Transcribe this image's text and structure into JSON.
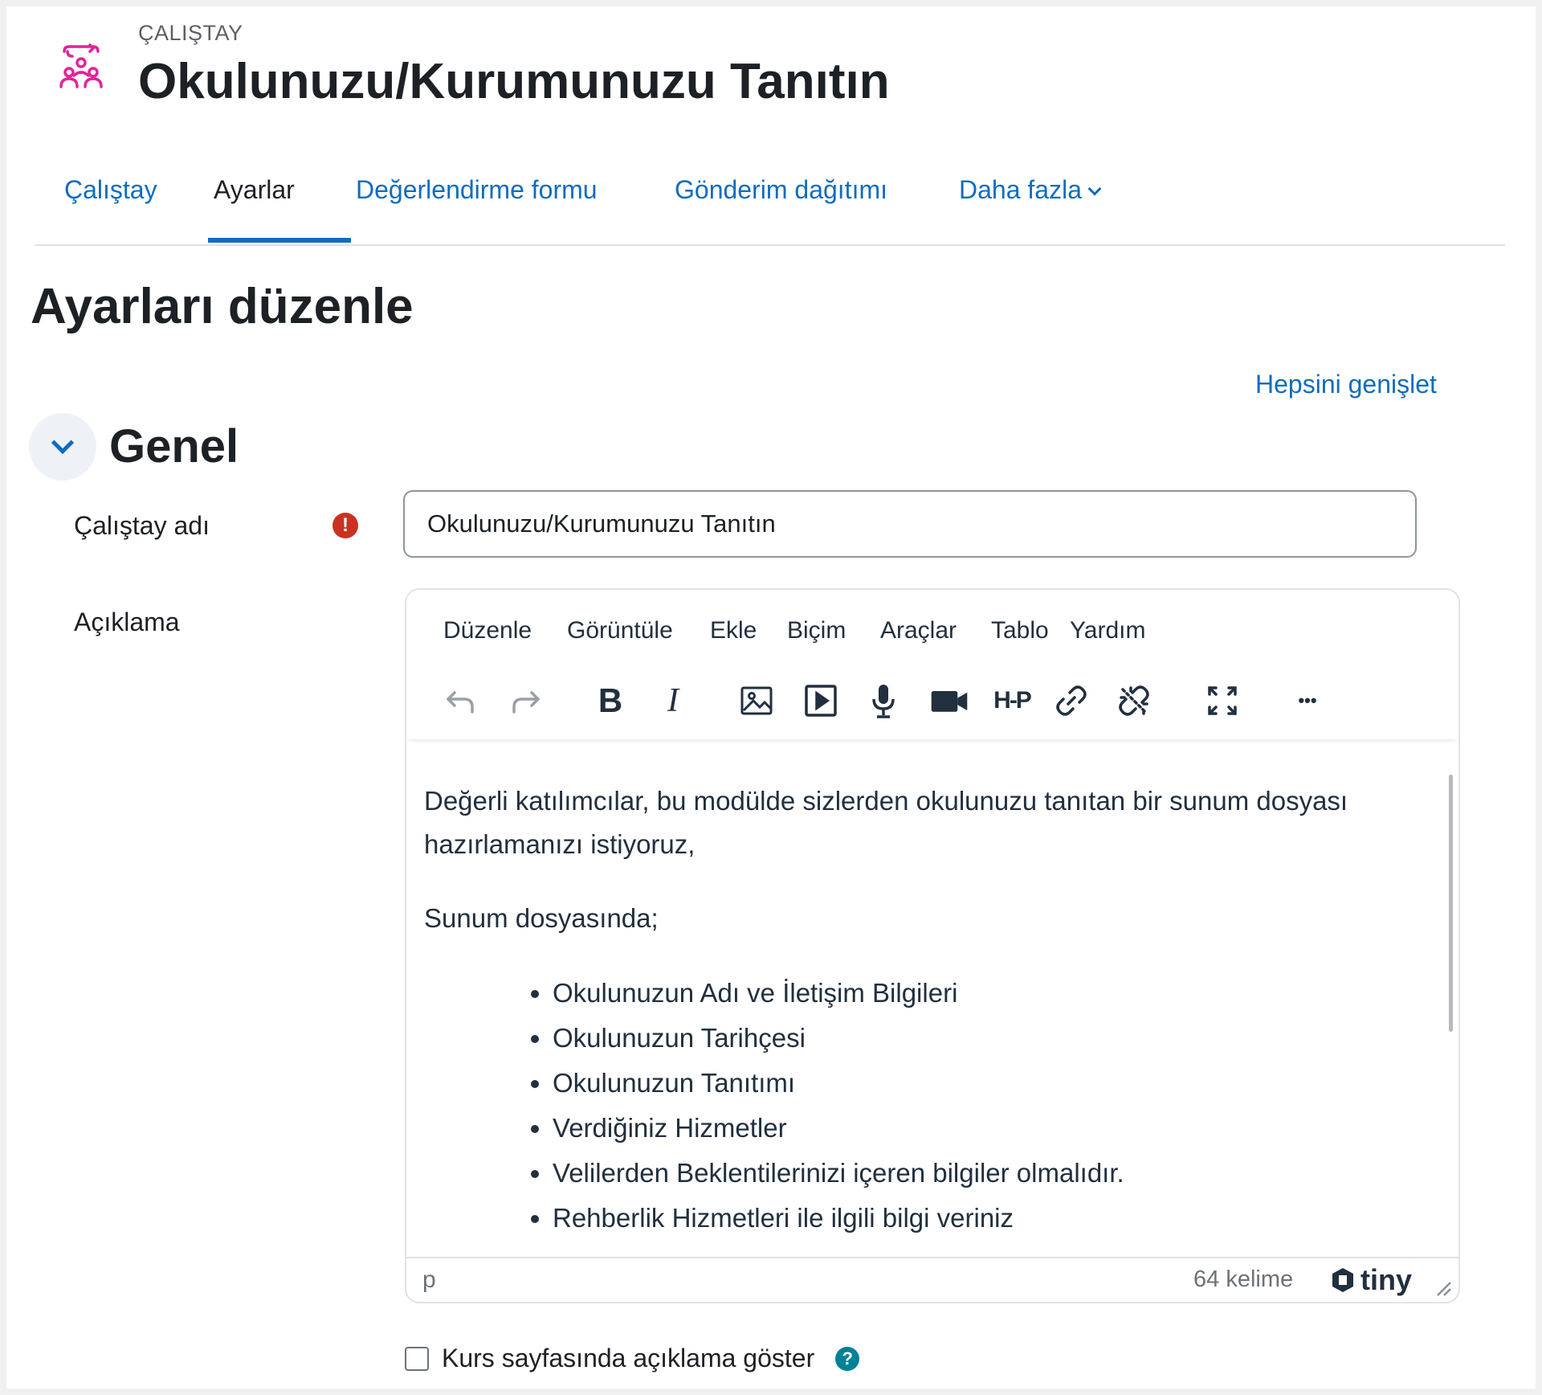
{
  "header": {
    "kicker": "ÇALIŞTAY",
    "title": "Okulunuzu/Kurumunuzu Tanıtın",
    "icon": "workshop-icon",
    "icon_color": "#e3229b"
  },
  "tabs": [
    {
      "label": "Çalıştay",
      "active": false
    },
    {
      "label": "Ayarlar",
      "active": true
    },
    {
      "label": "Değerlendirme formu",
      "active": false
    },
    {
      "label": "Gönderim dağıtımı",
      "active": false
    },
    {
      "label": "Daha fazla",
      "active": false
    }
  ],
  "page": {
    "heading": "Ayarları düzenle",
    "expand_all": "Hepsini genişlet"
  },
  "section": {
    "title": "Genel"
  },
  "form": {
    "name_label": "Çalıştay adı",
    "name_value": "Okulunuzu/Kurumunuzu Tanıtın",
    "required_mark": "!",
    "description_label": "Açıklama",
    "show_description_label": "Kurs sayfasında açıklama göster",
    "show_description_checked": false,
    "help_mark": "?"
  },
  "editor": {
    "menu": [
      "Düzenle",
      "Görüntüle",
      "Ekle",
      "Biçim",
      "Araçlar",
      "Tablo",
      "Yardım"
    ],
    "toolbar": [
      "undo-icon",
      "redo-icon",
      "bold-icon",
      "italic-icon",
      "image-icon",
      "media-icon",
      "microphone-icon",
      "video-camera-icon",
      "h5p-icon",
      "link-icon",
      "unlink-icon",
      "fullscreen-icon",
      "more-icon"
    ],
    "toolbar_labels": {
      "bold": "B",
      "italic": "I",
      "h5p": "H-P",
      "more": "•••"
    },
    "content": {
      "paragraph1": "Değerli katılımcılar, bu modülde sizlerden okulunuzu tanıtan bir sunum dosyası hazırlamanızı istiyoruz,",
      "paragraph2": "Sunum dosyasında;",
      "list": [
        "Okulunuzun Adı ve İletişim Bilgileri",
        "Okulunuzun Tarihçesi",
        "Okulunuzun Tanıtımı",
        "Verdiğiniz Hizmetler",
        "Velilerden Beklentilerinizi içeren bilgiler olmalıdır.",
        "Rehberlik Hizmetleri ile ilgili bilgi veriniz"
      ]
    },
    "status": {
      "path": "p",
      "word_count": "64 kelime",
      "brand": "tiny"
    }
  },
  "colors": {
    "link": "#0f6cbf",
    "required": "#ca3120",
    "help": "#008196"
  }
}
